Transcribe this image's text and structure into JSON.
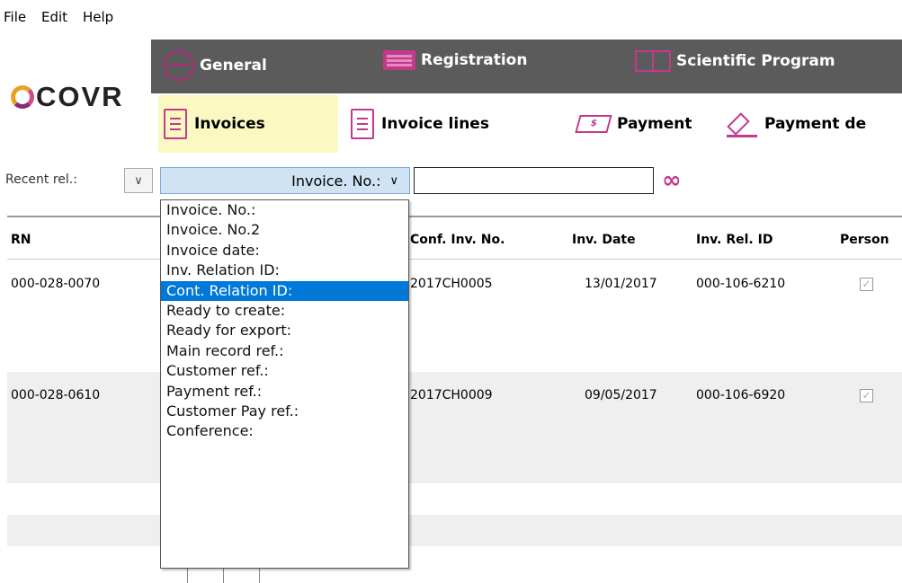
{
  "menu": {
    "file": "File",
    "edit": "Edit",
    "help": "Help"
  },
  "logo": {
    "text": "COVR"
  },
  "topnav": {
    "general": "General",
    "registration": "Registration",
    "scientific": "Scientific Program"
  },
  "subnav": {
    "invoices": "Invoices",
    "invoice_lines": "Invoice lines",
    "payment": "Payment",
    "payment_de": "Payment de"
  },
  "search": {
    "recent_label": "Recent rel.:",
    "field_value": "Invoice. No.:",
    "input_value": "",
    "chevron": "∨",
    "infinity": "∞"
  },
  "columns": {
    "rn": "RN",
    "conf_inv_no": "Conf. Inv. No.",
    "inv_date": "Inv. Date",
    "inv_rel_id": "Inv. Rel. ID",
    "person": "Person"
  },
  "rows": [
    {
      "rn": "000-028-0070",
      "conf_inv_no": "2017CH0005",
      "inv_date": "13/01/2017",
      "inv_rel_id": "000-106-6210",
      "check": "✓"
    },
    {
      "rn": "000-028-0610",
      "conf_inv_no": "2017CH0009",
      "inv_date": "09/05/2017",
      "inv_rel_id": "000-106-6920",
      "check": "✓"
    }
  ],
  "dropdown_options": [
    "Invoice. No.:",
    "Invoice. No.2",
    "Invoice date:",
    "Inv. Relation ID:",
    "Cont. Relation ID:",
    "Ready to create:",
    "Ready for export:",
    "Main record ref.:",
    "Customer ref.:",
    "Payment ref.:",
    "Customer Pay ref.:",
    "Conference:"
  ],
  "selected_option_index": 4,
  "colors": {
    "accent": "#c3398b",
    "topband": "#5b5b5b",
    "active_tab": "#fbf8c2",
    "selection": "#0078d7"
  }
}
